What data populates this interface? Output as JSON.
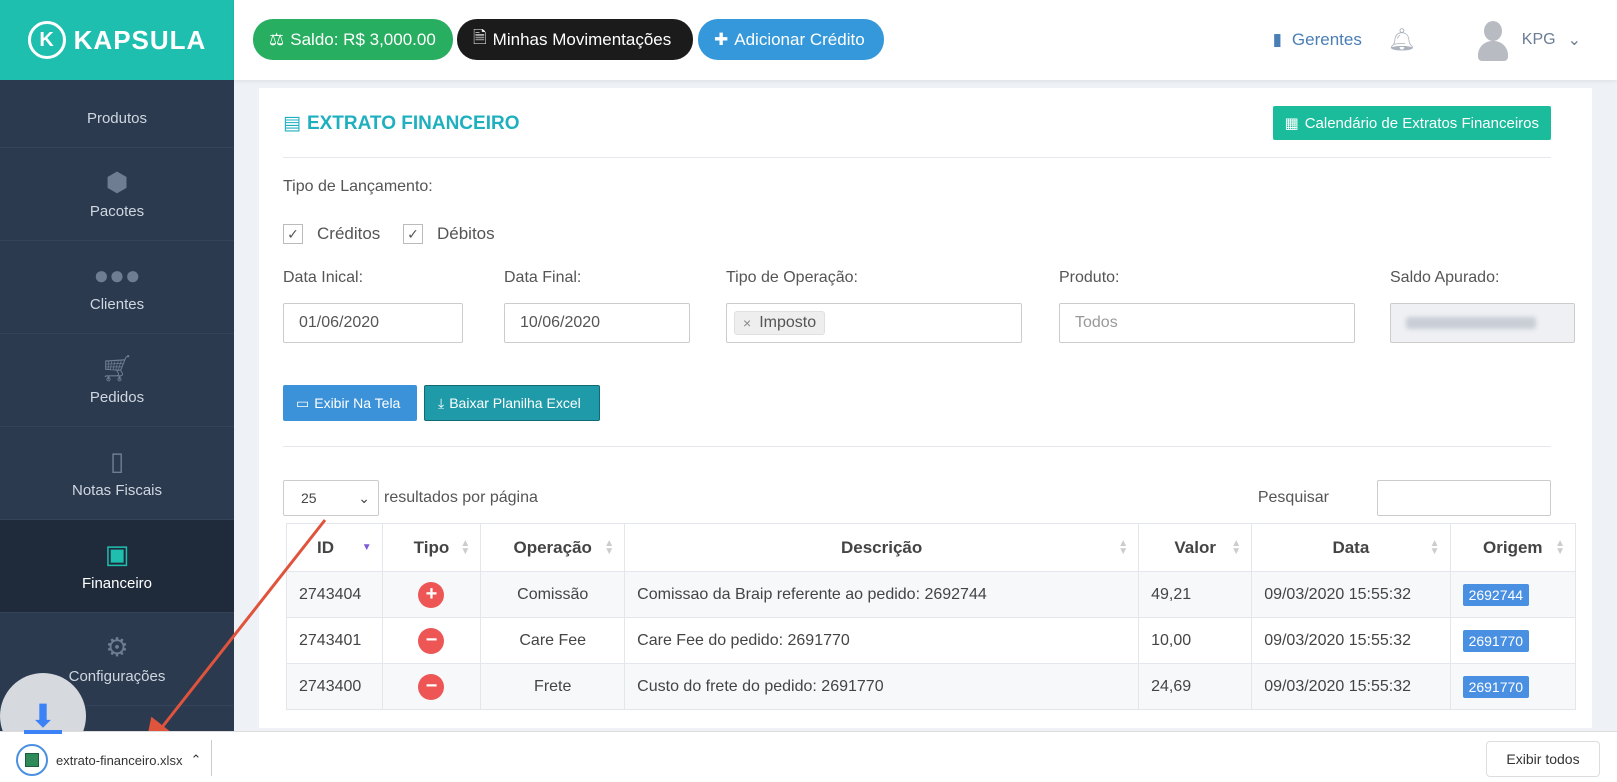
{
  "brand": {
    "name": "KAPSULA",
    "mark": "K"
  },
  "sidebar": {
    "items": [
      {
        "label": "Produtos",
        "icon": "box-icon"
      },
      {
        "label": "Pacotes",
        "icon": "cubes-icon"
      },
      {
        "label": "Clientes",
        "icon": "users-icon"
      },
      {
        "label": "Pedidos",
        "icon": "cart-icon"
      },
      {
        "label": "Notas Fiscais",
        "icon": "pdf-icon"
      },
      {
        "label": "Financeiro",
        "icon": "money-icon",
        "active": true
      },
      {
        "label": "Configurações",
        "icon": "gear-icon"
      }
    ]
  },
  "topbar": {
    "saldo": "Saldo: R$ 3,000.00",
    "movimentacoes": "Minhas Movimentações",
    "adicionar": "Adicionar Crédito",
    "gerentes": "Gerentes",
    "user": "KPG"
  },
  "main": {
    "title": "EXTRATO FINANCEIRO",
    "calendar_button": "Calendário de Extratos Financeiros",
    "tipo_label": "Tipo de Lançamento:",
    "creditos": "Créditos",
    "debitos": "Débitos",
    "data_inicial_label": "Data Inical:",
    "data_inicial": "01/06/2020",
    "data_final_label": "Data Final:",
    "data_final": "10/06/2020",
    "operacao_label": "Tipo de Operação:",
    "operacao_tag": "Imposto",
    "produto_label": "Produto:",
    "produto_placeholder": "Todos",
    "saldo_label": "Saldo Apurado:",
    "exibir_button": "Exibir Na Tela",
    "baixar_button": "Baixar Planilha Excel",
    "page_size": "25",
    "per_page": "resultados por página",
    "pesquisar": "Pesquisar"
  },
  "table": {
    "headers": [
      "ID",
      "Tipo",
      "Operação",
      "Descrição",
      "Valor",
      "Data",
      "Origem"
    ],
    "rows": [
      {
        "id": "2743404",
        "tipo": "credit",
        "operacao": "Comissão",
        "descricao": "Comissao da Braip referente ao pedido: 2692744",
        "valor": "49,21",
        "data": "09/03/2020 15:55:32",
        "origem": "2692744"
      },
      {
        "id": "2743401",
        "tipo": "debit",
        "operacao": "Care Fee",
        "descricao": "Care Fee do pedido: 2691770",
        "valor": "10,00",
        "data": "09/03/2020 15:55:32",
        "origem": "2691770"
      },
      {
        "id": "2743400",
        "tipo": "debit",
        "operacao": "Frete",
        "descricao": "Custo do frete do pedido: 2691770",
        "valor": "24,69",
        "data": "09/03/2020 15:55:32",
        "origem": "2691770"
      }
    ]
  },
  "download": {
    "filename": "extrato-financeiro.xlsx",
    "show_all": "Exibir todos"
  },
  "colors": {
    "sidebar": "#2b3a4e",
    "brand_teal": "#1fbfb0",
    "saldo_green": "#27ae60",
    "accent_blue": "#3498db",
    "debit_red": "#ee5656"
  }
}
